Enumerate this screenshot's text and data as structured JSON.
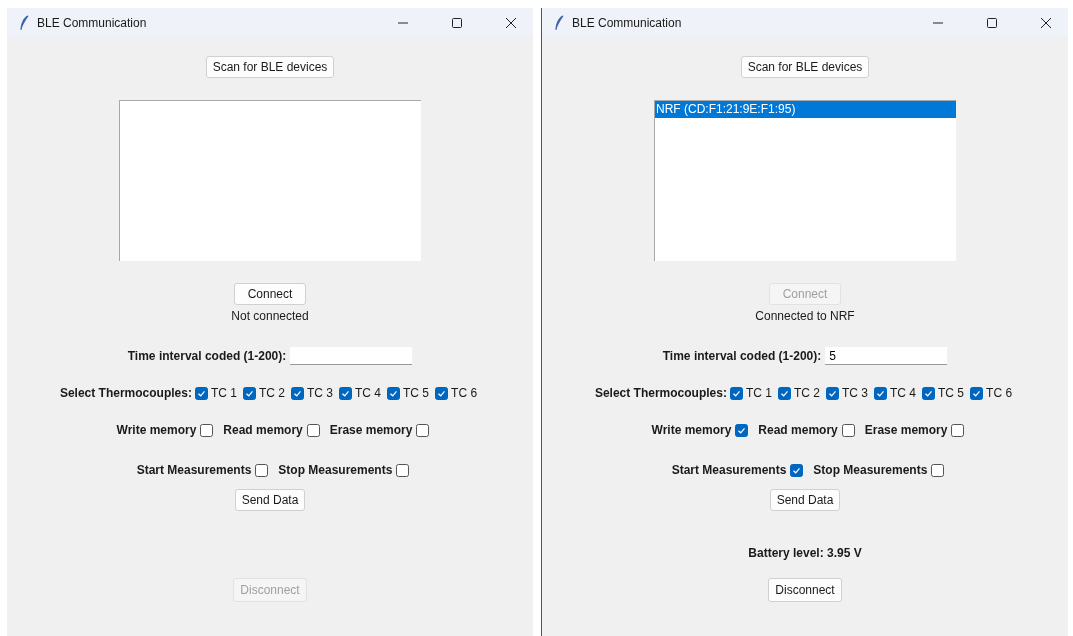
{
  "windows": [
    {
      "title": "BLE Communication",
      "scan_button": "Scan for BLE devices",
      "connect_button": {
        "label": "Connect",
        "disabled": false
      },
      "status": "Not connected",
      "interval": {
        "label": "Time interval coded (1-200):"
      },
      "thermocouples": {
        "label": "Select Thermocouples:",
        "items": [
          {
            "label": "TC 1",
            "checked": true
          },
          {
            "label": "TC 2",
            "checked": true
          },
          {
            "label": "TC 3",
            "checked": true
          },
          {
            "label": "TC 4",
            "checked": true
          },
          {
            "label": "TC 5",
            "checked": true
          },
          {
            "label": "TC 6",
            "checked": true
          }
        ]
      },
      "memory_options": [
        {
          "label": "Write memory",
          "checked": false
        },
        {
          "label": "Read memory",
          "checked": false
        },
        {
          "label": "Erase memory",
          "checked": false
        }
      ],
      "measurement_options": [
        {
          "label": "Start Measurements",
          "checked": false
        },
        {
          "label": "Stop Measurements",
          "checked": false
        }
      ],
      "send_button": "Send Data",
      "disconnect_button": {
        "label": "Disconnect",
        "disabled": true
      }
    },
    {
      "title": "BLE Communication",
      "scan_button": "Scan for BLE devices",
      "devices": [
        {
          "label": "NRF (CD:F1:21:9E:F1:95)",
          "selected": true
        }
      ],
      "connect_button": {
        "label": "Connect",
        "disabled": true
      },
      "status": "Connected to NRF",
      "interval": {
        "label": "Time interval coded (1-200):",
        "value": "5"
      },
      "thermocouples": {
        "label": "Select Thermocouples:",
        "items": [
          {
            "label": "TC 1",
            "checked": true
          },
          {
            "label": "TC 2",
            "checked": true
          },
          {
            "label": "TC 3",
            "checked": true
          },
          {
            "label": "TC 4",
            "checked": true
          },
          {
            "label": "TC 5",
            "checked": true
          },
          {
            "label": "TC 6",
            "checked": true
          }
        ]
      },
      "memory_options": [
        {
          "label": "Write memory",
          "checked": true
        },
        {
          "label": "Read memory",
          "checked": false
        },
        {
          "label": "Erase memory",
          "checked": false
        }
      ],
      "measurement_options": [
        {
          "label": "Start Measurements",
          "checked": true
        },
        {
          "label": "Stop Measurements",
          "checked": false
        }
      ],
      "send_button": "Send Data",
      "battery": "Battery level: 3.95 V",
      "disconnect_button": {
        "label": "Disconnect",
        "disabled": false
      }
    }
  ]
}
